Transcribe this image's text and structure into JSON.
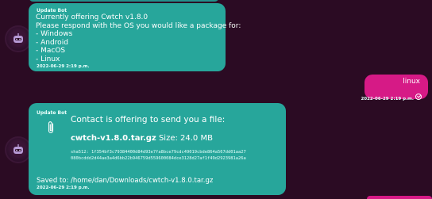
{
  "messages": [
    {
      "sender": "Update Bot",
      "lines": [
        "Currently offering Cwtch v1.8.0",
        "Please respond with the OS you would like a package for:",
        "- Windows",
        "- Android",
        "- MacOS",
        "- Linux"
      ],
      "timestamp": "2022-06-29 2:19 p.m."
    },
    {
      "text": "linux",
      "timestamp": "2022-06-29 2:19 p.m.",
      "status_icon": "check-circle-icon"
    },
    {
      "sender": "Update Bot",
      "file_offer_title": "Contact is offering to send you a file:",
      "file_name": "cwtch-v1.8.0.tar.gz",
      "file_size": "Size: 24.0 MB",
      "sha_line1": "sha512: 1f354bf3c79384400d84d93e7fa8bce79cdc49019cbde864a567dd01aa27",
      "sha_line2": "080bcddd2d44ae3a4d6bb22b946759d559600084dce3128d27af1f49d2923981a26a",
      "saved_to": "Saved to: /home/dan/Downloads/cwtch-v1.8.0.tar.gz",
      "timestamp": "2022-06-29 2:19 p.m.",
      "icon": "paperclip-icon"
    }
  ],
  "colors": {
    "background": "#2b0b23",
    "incoming_bubble": "#27a69b",
    "outgoing_bubble": "#d61a86"
  }
}
